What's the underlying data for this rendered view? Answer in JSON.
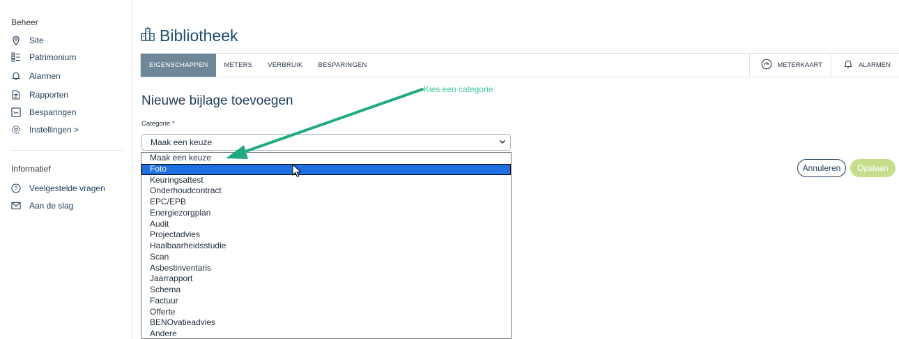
{
  "sidebar": {
    "section_beheer": "Beheer",
    "items_beheer": [
      {
        "label": "Site",
        "icon": "location-pin-icon"
      },
      {
        "label": "Patrimonium",
        "icon": "list-icon"
      },
      {
        "label": "Alarmen",
        "icon": "bell-icon"
      },
      {
        "label": "Rapporten",
        "icon": "document-icon"
      },
      {
        "label": "Besparingen",
        "icon": "savings-chart-icon"
      },
      {
        "label": "Instellingen >",
        "icon": "gear-icon"
      }
    ],
    "section_informatief": "Informatief",
    "items_informatief": [
      {
        "label": "Veelgestelde vragen",
        "icon": "question-icon"
      },
      {
        "label": "Aan de slag",
        "icon": "mail-icon"
      }
    ]
  },
  "header": {
    "title": "Bibliotheek",
    "icon": "building-icon"
  },
  "tabs": {
    "items": [
      "EIGENSCHAPPEN",
      "METERS",
      "VERBRUIK",
      "BESPARINGEN"
    ],
    "active": "EIGENSCHAPPEN",
    "right_buttons": [
      "METERKAART",
      "ALARMEN"
    ]
  },
  "form": {
    "title": "Nieuwe bijlage toevoegen",
    "category_label": "Categorie *",
    "selected_value": "Maak een keuze",
    "options": [
      "Maak een keuze",
      "Foto",
      "Keuringsattest",
      "Onderhoudcontract",
      "EPC/EPB",
      "Energiezorgplan",
      "Audit",
      "Projectadvies",
      "Haalbaarheidsstudie",
      "Scan",
      "Asbestinventaris",
      "Jaarrapport",
      "Schema",
      "Factuur",
      "Offerte",
      "BENOvatieadvies",
      "Andere"
    ],
    "highlighted_option": "Foto"
  },
  "buttons": {
    "cancel": "Annuleren",
    "save": "Opslaan"
  },
  "annotation": {
    "text": "Kies een categorie",
    "color": "#3ec9a2"
  },
  "colors": {
    "active_tab": "#6e8799",
    "highlight": "#1e6fe0",
    "save_disabled": "#c6dd8c",
    "primary_text": "#1f3b5a"
  }
}
